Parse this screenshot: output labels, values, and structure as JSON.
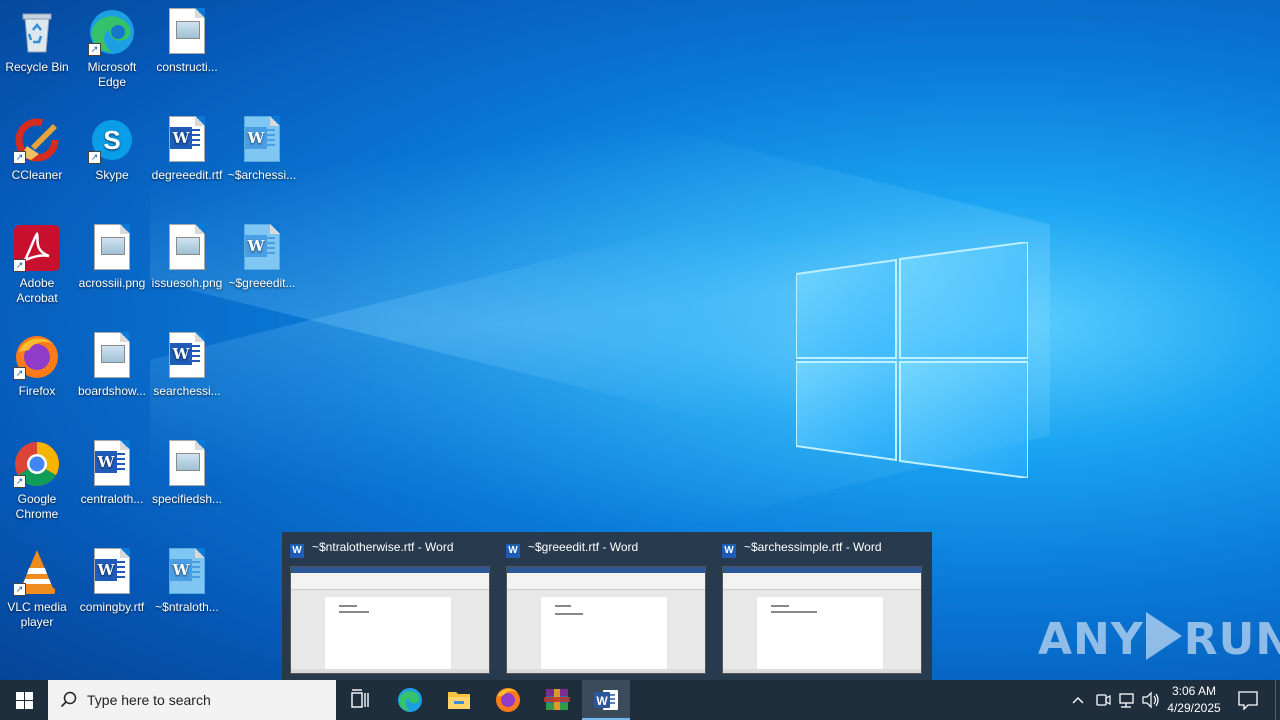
{
  "desktop": {
    "icons": [
      {
        "label": "Recycle Bin"
      },
      {
        "label": "Microsoft Edge"
      },
      {
        "label": "constructi..."
      },
      {
        "label": "CCleaner"
      },
      {
        "label": "Skype"
      },
      {
        "label": "degreeedit.rtf"
      },
      {
        "label": "~$archessi..."
      },
      {
        "label": "Adobe Acrobat"
      },
      {
        "label": "acrossiii.png"
      },
      {
        "label": "issuesoh.png"
      },
      {
        "label": "~$greeedit..."
      },
      {
        "label": "Firefox"
      },
      {
        "label": "boardshow..."
      },
      {
        "label": "searchessi..."
      },
      {
        "label": "Google Chrome"
      },
      {
        "label": "centraloth..."
      },
      {
        "label": "specifiedsh..."
      },
      {
        "label": "VLC media player"
      },
      {
        "label": "comingby.rtf"
      },
      {
        "label": "~$ntraloth..."
      }
    ]
  },
  "previews": [
    {
      "title": "~$ntralotherwise.rtf - Word",
      "app_icon": "word-icon"
    },
    {
      "title": "~$greeedit.rtf - Word",
      "app_icon": "word-icon"
    },
    {
      "title": "~$archessimple.rtf - Word",
      "app_icon": "word-icon"
    }
  ],
  "watermark": {
    "left": "ANY",
    "right": "RUN"
  },
  "taskbar": {
    "search_placeholder": "Type here to search",
    "pinned": [
      "task-view-icon",
      "edge-icon",
      "file-explorer-icon",
      "firefox-icon",
      "winrar-icon",
      "word-icon"
    ],
    "active": "word-icon"
  },
  "clock": {
    "time": "3:06 AM",
    "date": "4/29/2025"
  },
  "colors": {
    "taskbar": "#1f2e3d",
    "accent": "#76b9ed",
    "desktop": "#0a78d6"
  }
}
